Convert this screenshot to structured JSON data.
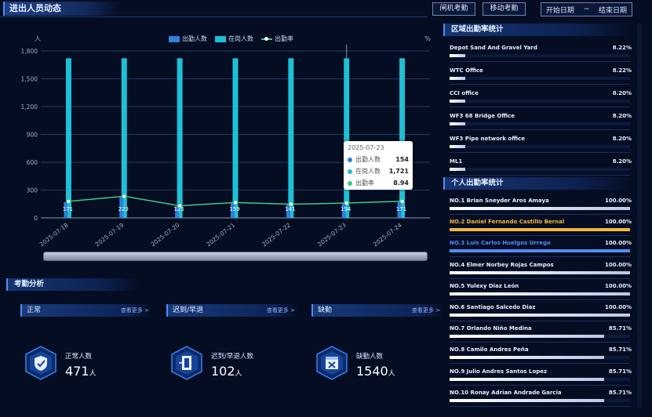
{
  "header": {
    "title": "进出人员动态",
    "btn_gate": "闸机考勤",
    "btn_mobile": "移动考勤",
    "start_date": "开始日期",
    "tilde": "~",
    "end_date": "结束日期"
  },
  "chart_data": {
    "type": "bar",
    "categories": [
      "2025-07-18",
      "2025-07-19",
      "2025-07-20",
      "2025-07-21",
      "2025-07-22",
      "2025-07-23",
      "2025-07-24"
    ],
    "series": [
      {
        "name": "出勤人数",
        "values": [
          171,
          223,
          125,
          159,
          141,
          154,
          171
        ],
        "color": "#2f7fdc"
      },
      {
        "name": "在岗人数",
        "values": [
          1721,
          1721,
          1721,
          1721,
          1721,
          1721,
          1721
        ],
        "color": "#1fbfd6"
      },
      {
        "name": "出勤率",
        "values": [
          9.94,
          12.96,
          7.26,
          9.24,
          8.19,
          8.94,
          9.94
        ],
        "color": "#3ec98a"
      }
    ],
    "data_labels": [
      "171",
      "223",
      "125",
      "159",
      "141",
      "154",
      "171"
    ],
    "ylabel": "人",
    "y2label": "%",
    "ylim": [
      0,
      1800
    ],
    "yticks": [
      "0",
      "300",
      "600",
      "900",
      "1,200",
      "1,500",
      "1,800"
    ],
    "grid": true,
    "legend_position": "top"
  },
  "tooltip": {
    "date": "2025-07-23",
    "rows": [
      {
        "label": "出勤人数",
        "value": "154",
        "color": "#2f7fdc"
      },
      {
        "label": "在岗人数",
        "value": "1,721",
        "color": "#1fbfd6"
      },
      {
        "label": "出勤率",
        "value": "8.94",
        "color": "#3ec98a"
      }
    ]
  },
  "analysis": {
    "title": "考勤分析",
    "more": "查看更多 >",
    "cards": [
      {
        "head": "正常",
        "label": "正常人数",
        "value": "471",
        "unit": "人",
        "icon": "shield-check-icon"
      },
      {
        "head": "迟到/早退",
        "label": "迟到/早退人数",
        "value": "102",
        "unit": "人",
        "icon": "door-exit-icon"
      },
      {
        "head": "缺勤",
        "label": "缺勤人数",
        "value": "1540",
        "unit": "人",
        "icon": "calendar-x-icon"
      }
    ]
  },
  "region": {
    "title": "区域出勤率统计",
    "items": [
      {
        "name": "Depot Sand And Gravel Yard",
        "pct": "8.22%",
        "ratio": 0.0822
      },
      {
        "name": "WTC Office",
        "pct": "8.22%",
        "ratio": 0.0822
      },
      {
        "name": "CCI office",
        "pct": "8.20%",
        "ratio": 0.082
      },
      {
        "name": "WF3 68 Bridge Office",
        "pct": "8.20%",
        "ratio": 0.082
      },
      {
        "name": "WF3 Pipe network office",
        "pct": "8.20%",
        "ratio": 0.082
      },
      {
        "name": "ML1",
        "pct": "8.20%",
        "ratio": 0.082
      }
    ]
  },
  "personal": {
    "title": "个人出勤率统计",
    "items": [
      {
        "name": "NO.1 Brian Sneyder Aros Amaya",
        "pct": "100.00%",
        "ratio": 1.0,
        "color": "#ffffff"
      },
      {
        "name": "NO.2 Daniel Fernando Castillo Bernal",
        "pct": "100.00%",
        "ratio": 1.0,
        "color": "#f2b63a"
      },
      {
        "name": "NO.3 Luis Carlos Huelgos Urrego",
        "pct": "100.00%",
        "ratio": 1.0,
        "color": "#4f8cff"
      },
      {
        "name": "NO.4 Elmer Norbey Rojas  Campos",
        "pct": "100.00%",
        "ratio": 1.0,
        "color": "#ffffff"
      },
      {
        "name": "NO.5 Yulexy Diaz León",
        "pct": "100.00%",
        "ratio": 1.0,
        "color": "#ffffff"
      },
      {
        "name": "NO.6 Santiago Salcedo Diaz",
        "pct": "100.00%",
        "ratio": 1.0,
        "color": "#ffffff"
      },
      {
        "name": "NO.7 Orlando Niño Medina",
        "pct": "85.71%",
        "ratio": 0.8571,
        "color": "#ffffff"
      },
      {
        "name": "NO.8 Camilo Andres Peña",
        "pct": "85.71%",
        "ratio": 0.8571,
        "color": "#ffffff"
      },
      {
        "name": "NO.9 Julio Andres Santos Lopez",
        "pct": "85.71%",
        "ratio": 0.8571,
        "color": "#ffffff"
      },
      {
        "name": "NO.10 Ronay Adrian Andrade Garcia",
        "pct": "85.71%",
        "ratio": 0.8571,
        "color": "#ffffff"
      }
    ]
  }
}
